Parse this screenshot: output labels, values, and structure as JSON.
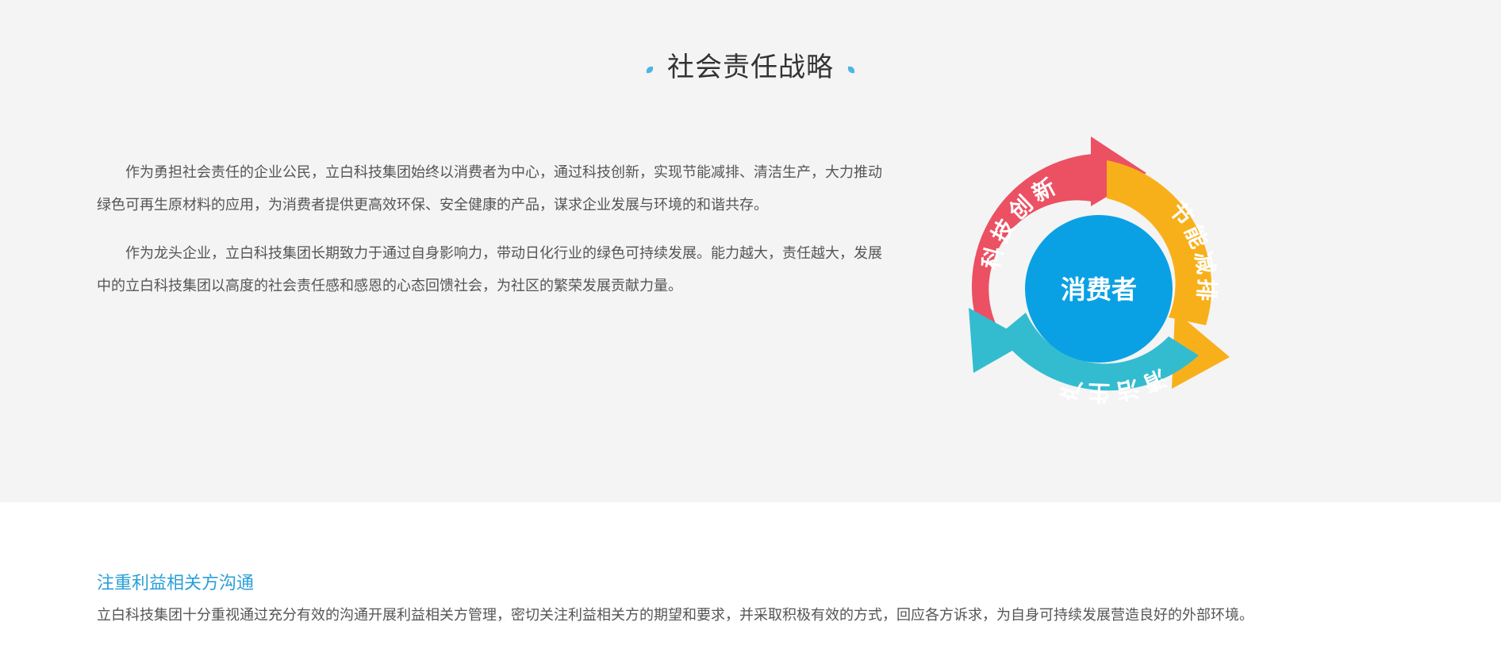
{
  "strategy": {
    "title": "社会责任战略",
    "paragraphs": [
      "作为勇担社会责任的企业公民，立白科技集团始终以消费者为中心，通过科技创新，实现节能减排、清洁生产，大力推动绿色可再生原材料的应用，为消费者提供更高效环保、安全健康的产品，谋求企业发展与环境的和谐共存。",
      "作为龙头企业，立白科技集团长期致力于通过自身影响力，带动日化行业的绿色可持续发展。能力越大，责任越大，发展中的立白科技集团以高度的社会责任感和感恩的心态回馈社会，为社区的繁荣发展贡献力量。"
    ]
  },
  "cycle": {
    "center": "消费者",
    "segments": [
      {
        "label": "科技创新",
        "color": "#ec5063"
      },
      {
        "label": "节能减排",
        "color": "#f8b01a"
      },
      {
        "label": "清洁生产",
        "color": "#33bccf"
      }
    ],
    "center_color": "#0aa1e4",
    "accent_dot_color": "#4fb5e2"
  },
  "stakeholder": {
    "heading": "注重利益相关方沟通",
    "text": "立白科技集团十分重视通过充分有效的沟通开展利益相关方管理，密切关注利益相关方的期望和要求，并采取积极有效的方式，回应各方诉求，为自身可持续发展营造良好的外部环境。"
  }
}
